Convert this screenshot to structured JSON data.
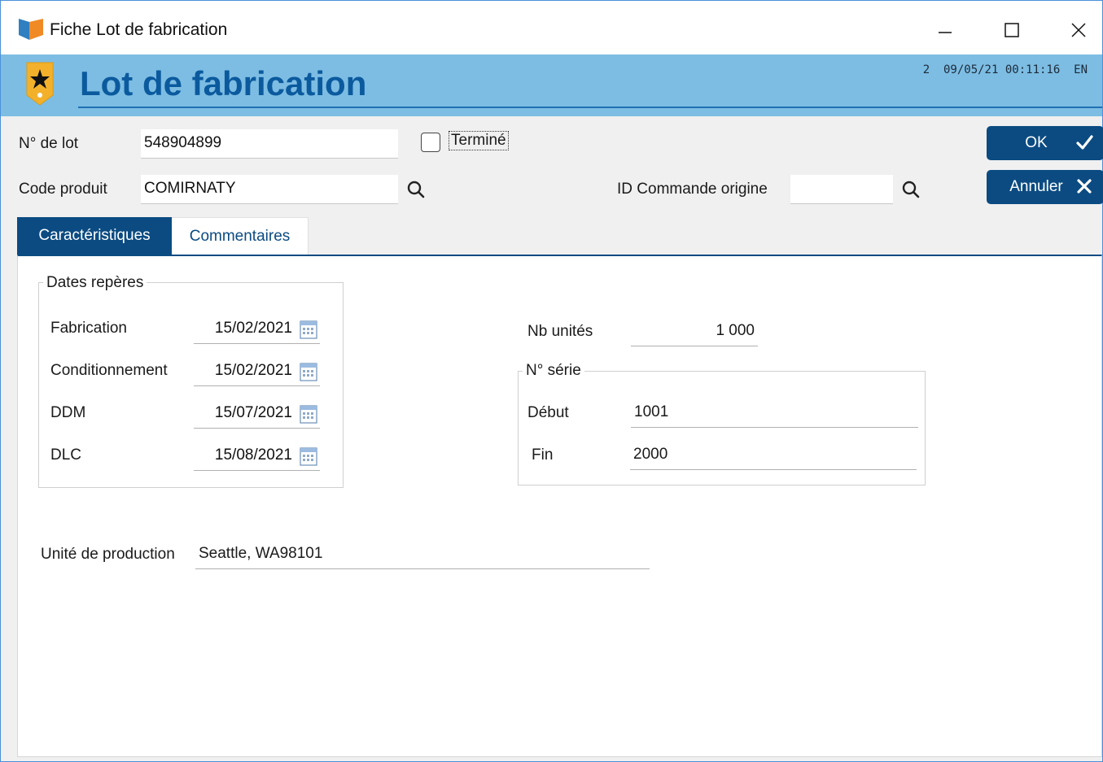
{
  "window": {
    "title": "Fiche Lot de fabrication",
    "minimize_glyph": "—",
    "maximize_glyph": "☐",
    "close_glyph": "✕"
  },
  "header": {
    "title": "Lot de fabrication",
    "info": "2  09/05/21 00:11:16  EN",
    "badge_icon": "star-badge-icon"
  },
  "form": {
    "lot_label": "N° de lot",
    "lot_value": "548904899",
    "finished_label": "Terminé",
    "finished_checked": false,
    "product_label": "Code produit",
    "product_value": "COMIRNATY",
    "order_label": "ID Commande origine",
    "order_value": ""
  },
  "buttons": {
    "ok_label": "OK",
    "cancel_label": "Annuler"
  },
  "tabs": [
    {
      "label": "Caractéristiques",
      "active": true
    },
    {
      "label": "Commentaires",
      "active": false
    }
  ],
  "dates_group": {
    "title": "Dates repères",
    "rows": [
      {
        "label": "Fabrication",
        "value": "15/02/2021"
      },
      {
        "label": "Conditionnement",
        "value": "15/02/2021"
      },
      {
        "label": "DDM",
        "value": "15/07/2021"
      },
      {
        "label": "DLC",
        "value": "15/08/2021"
      }
    ]
  },
  "units": {
    "label": "Nb unités",
    "value": "1 000"
  },
  "serial_group": {
    "title": "N° série",
    "start_label": "Début",
    "start_value": "1001",
    "end_label": "Fin",
    "end_value": "2000"
  },
  "production": {
    "label": "Unité de production",
    "value": "Seattle, WA98101"
  },
  "colors": {
    "header_band": "#7dbde3",
    "header_title": "#0b5a9e",
    "primary_button": "#0b4b82"
  }
}
